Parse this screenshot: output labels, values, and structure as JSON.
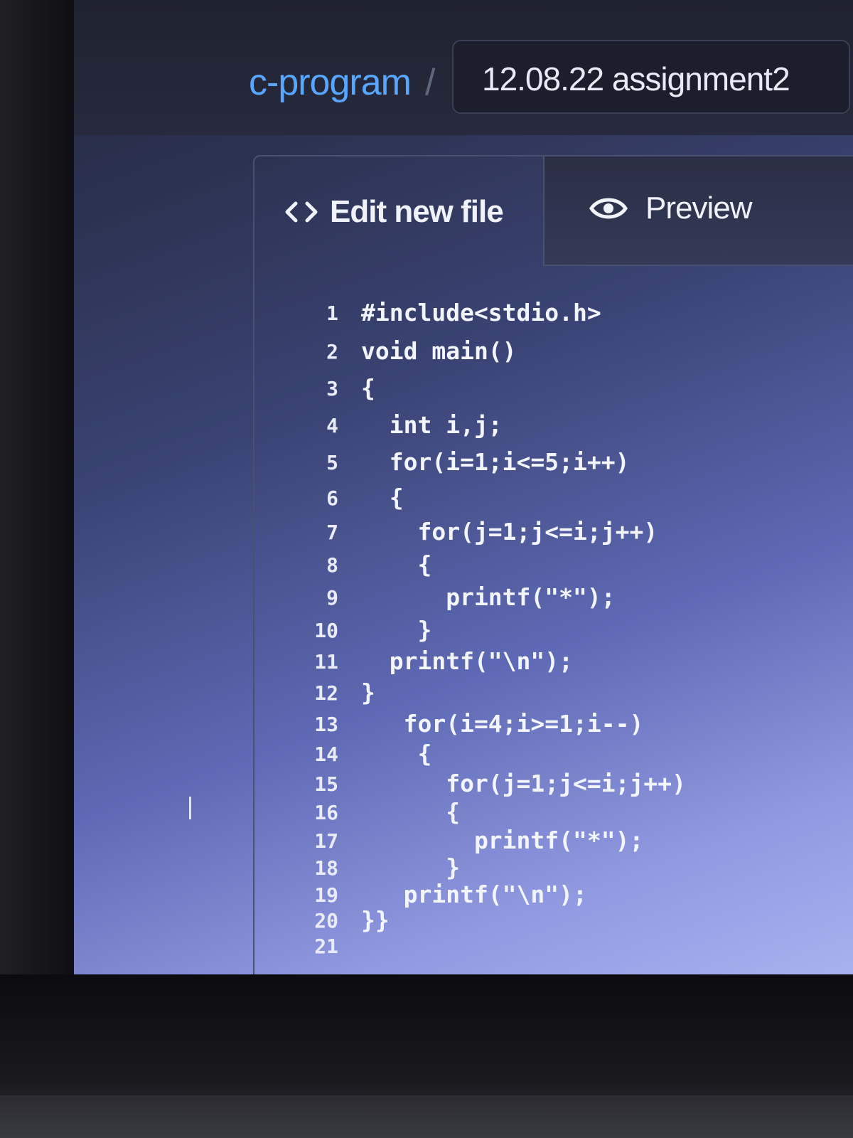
{
  "breadcrumb": {
    "repo": "c-program",
    "separator": "/",
    "filename": "12.08.22 assignment2"
  },
  "tabs": {
    "edit_label": "Edit new file",
    "preview_label": "Preview",
    "edit_icon": "code-brackets-icon",
    "preview_icon": "eye-icon"
  },
  "editor": {
    "lines": [
      {
        "num": "1",
        "text": "#include<stdio.h>"
      },
      {
        "num": "2",
        "text": "void main()"
      },
      {
        "num": "3",
        "text": "{"
      },
      {
        "num": "4",
        "text": "  int i,j;"
      },
      {
        "num": "5",
        "text": "  for(i=1;i<=5;i++)"
      },
      {
        "num": "6",
        "text": "  {"
      },
      {
        "num": "7",
        "text": "    for(j=1;j<=i;j++)"
      },
      {
        "num": "8",
        "text": "    {"
      },
      {
        "num": "9",
        "text": "      printf(\"*\");"
      },
      {
        "num": "10",
        "text": "    }"
      },
      {
        "num": "11",
        "text": "  printf(\"\\n\");"
      },
      {
        "num": "12",
        "text": "}"
      },
      {
        "num": "13",
        "text": "   for(i=4;i>=1;i--)"
      },
      {
        "num": "14",
        "text": "    {"
      },
      {
        "num": "15",
        "text": "      for(j=1;j<=i;j++)"
      },
      {
        "num": "16",
        "text": "      {"
      },
      {
        "num": "17",
        "text": "        printf(\"*\");"
      },
      {
        "num": "18",
        "text": "      }"
      },
      {
        "num": "19",
        "text": "   printf(\"\\n\");"
      },
      {
        "num": "20",
        "text": "}}"
      },
      {
        "num": "21",
        "text": ""
      }
    ]
  },
  "colors": {
    "repo_link": "#58a6ff",
    "text": "#f3f5fc"
  }
}
